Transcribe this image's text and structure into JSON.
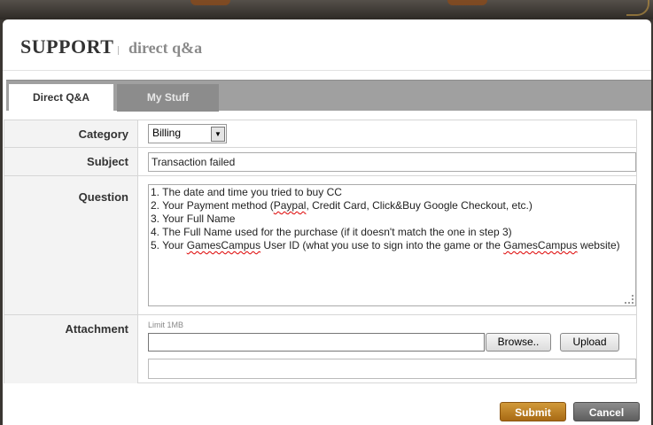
{
  "header": {
    "title": "SUPPORT",
    "subtitle": "direct q&a"
  },
  "tabs": [
    {
      "label": "Direct Q&A",
      "active": true
    },
    {
      "label": "My Stuff",
      "active": false
    }
  ],
  "form": {
    "category": {
      "label": "Category",
      "value": "Billing"
    },
    "subject": {
      "label": "Subject",
      "value": "Transaction failed"
    },
    "question": {
      "label": "Question",
      "lines": [
        "1. The date and time you tried to buy CC",
        "2. Your Payment method (Paypal, Credit Card, Click&Buy Google Checkout, etc.)",
        "3. Your Full Name",
        "4. The Full Name used for the purchase (if it doesn't match the one in step 3)",
        "5. Your GamesCampus User ID (what you use to sign into the game or the GamesCampus website)"
      ]
    },
    "attachment": {
      "label": "Attachment",
      "limit": "Limit 1MB",
      "file_path": "",
      "browse_label": "Browse..",
      "upload_label": "Upload",
      "file_list": ""
    }
  },
  "actions": {
    "submit_label": "Submit",
    "cancel_label": "Cancel"
  },
  "colors": {
    "submit": "#b87a20",
    "cancel": "#707070",
    "tabbar": "#a0a0a0"
  }
}
